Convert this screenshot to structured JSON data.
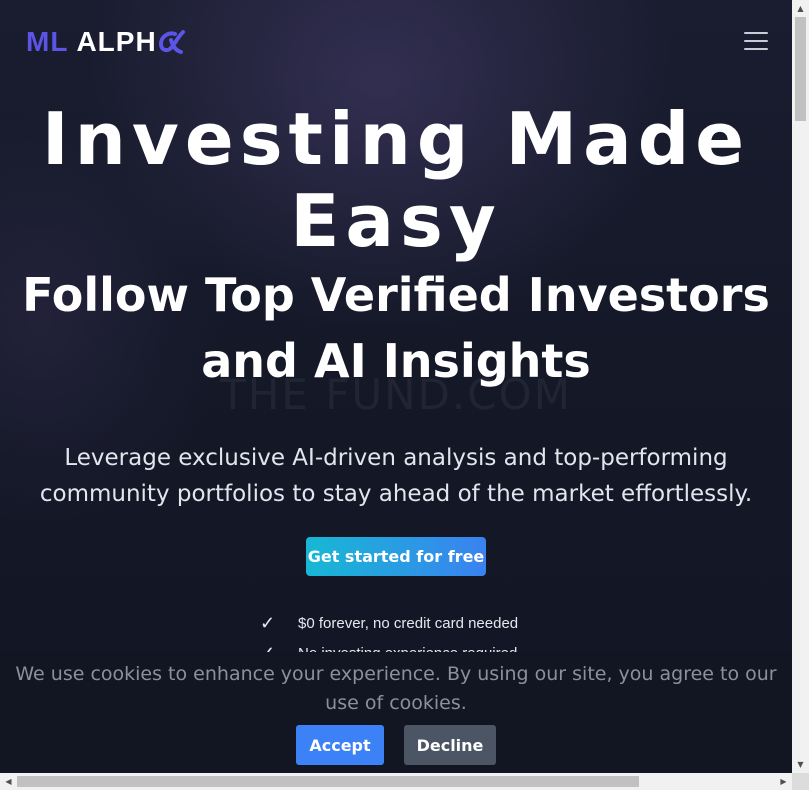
{
  "header": {
    "logo_ml": "ML",
    "logo_alpha": "ALPH",
    "menu_icon": "hamburger-menu-icon"
  },
  "hero": {
    "title_line1": "Investing Made",
    "title_line2": "Easy",
    "subtitle_line1": "Follow Top Verified Investors",
    "subtitle_line2": "and AI Insights",
    "watermark": "THE FUND.COM",
    "description": "Leverage exclusive AI-driven analysis and top-performing community portfolios to stay ahead of the market effortlessly.",
    "cta_label": "Get started for free",
    "features": [
      "$0 forever, no credit card needed",
      "No investing experience required"
    ]
  },
  "cookie_banner": {
    "text": "We use cookies to enhance your experience. By using our site, you agree to our use of cookies.",
    "accept_label": "Accept",
    "decline_label": "Decline"
  },
  "colors": {
    "logo_ml": "#5b54e6",
    "cta_start": "#17b8d4",
    "cta_end": "#3a82f0",
    "accept": "#3c82f6",
    "decline": "#4b5563"
  }
}
